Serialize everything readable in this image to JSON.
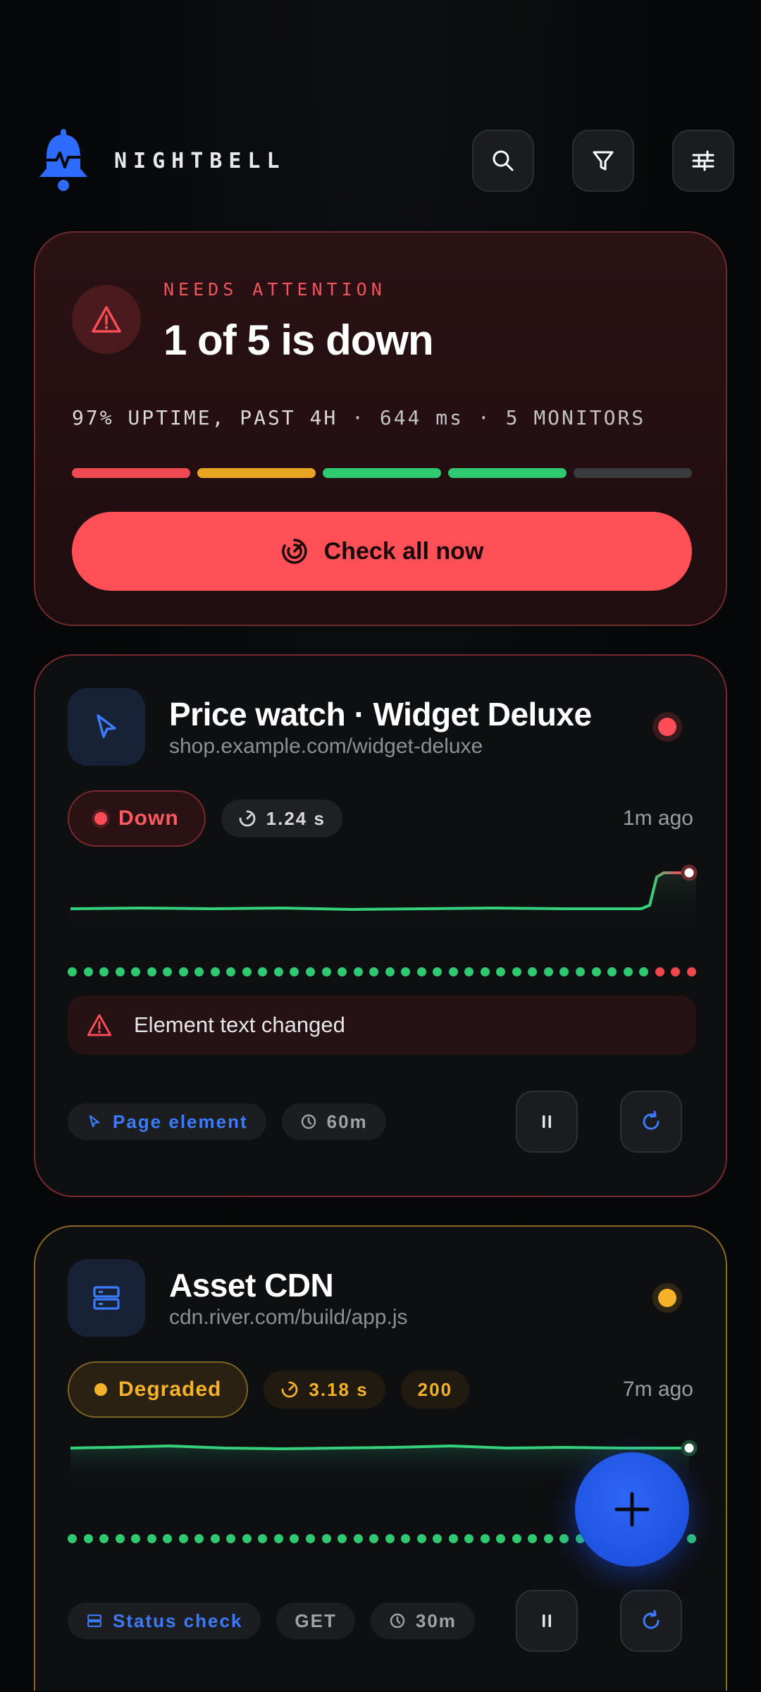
{
  "app": {
    "brand": "NIGHTBELL"
  },
  "header": {
    "icons": [
      "search-icon",
      "filter-icon",
      "sliders-icon"
    ]
  },
  "summary": {
    "eyebrow": "NEEDS ATTENTION",
    "title": "1 of 5 is down",
    "uptime": "97% UPTIME, PAST 4H",
    "latency": "644 ms",
    "monitors": "5 MONITORS",
    "separator": "·",
    "segments": [
      "#ee4a52",
      "#e8a423",
      "#2fc972",
      "#2fc972",
      "#3a3b3e"
    ],
    "check_all_label": "Check all now"
  },
  "monitors": [
    {
      "name": "Price watch · Widget Deluxe",
      "url": "shop.example.com/widget-deluxe",
      "status": "Down",
      "response": "1.24 s",
      "ago": "1m ago",
      "alert": "Element text changed",
      "type": "Page element",
      "interval": "60m",
      "status_color": "#ff4d57",
      "checks": [
        "up",
        "up",
        "up",
        "up",
        "up",
        "up",
        "up",
        "up",
        "up",
        "up",
        "up",
        "up",
        "up",
        "up",
        "up",
        "up",
        "up",
        "up",
        "up",
        "up",
        "up",
        "up",
        "up",
        "up",
        "up",
        "up",
        "up",
        "up",
        "up",
        "up",
        "up",
        "up",
        "up",
        "up",
        "up",
        "up",
        "up",
        "up",
        "up",
        "up",
        "up",
        "up",
        "up",
        "up",
        "up",
        "up",
        "up",
        "up",
        "up",
        "up",
        "up",
        "up",
        "up",
        "up",
        "up",
        "up",
        "up",
        "up",
        "up",
        "up",
        "up",
        "up",
        "up",
        "up",
        "up",
        "up",
        "up",
        "up",
        "up",
        "up",
        "up",
        "up",
        "up",
        "up",
        "up",
        "up",
        "up",
        "up",
        "up",
        "up",
        "up",
        "up",
        "up",
        "down",
        "down",
        "down"
      ]
    },
    {
      "name": "Asset CDN",
      "url": "cdn.river.com/build/app.js",
      "status": "Degraded",
      "response": "3.18 s",
      "code": "200",
      "ago": "7m ago",
      "type": "Status check",
      "method": "GET",
      "interval": "30m",
      "status_color": "#f5b12a"
    }
  ],
  "fab": {
    "icon": "plus-icon"
  }
}
